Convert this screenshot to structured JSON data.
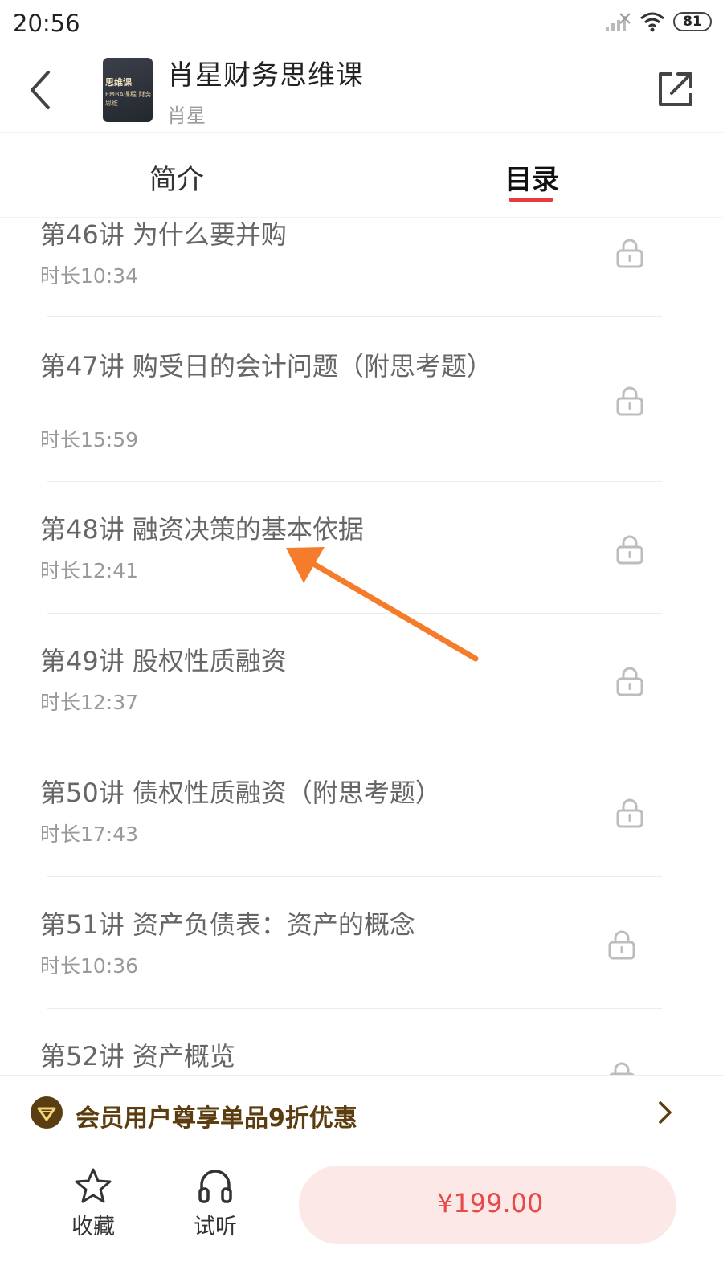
{
  "status_bar": {
    "time": "20:56",
    "battery": "81"
  },
  "header": {
    "title": "肖星财务思维课",
    "author": "肖星",
    "cover_title": "思维课",
    "cover_subtitle": "EMBA课程 财务思维"
  },
  "tabs": [
    {
      "label": "简介",
      "active": false
    },
    {
      "label": "目录",
      "active": true
    }
  ],
  "lessons": [
    {
      "title": "第46讲 为什么要并购",
      "duration": "时长10:34",
      "locked": true
    },
    {
      "title": "第47讲 购受日的会计问题（附思考题）",
      "duration": "时长15:59",
      "locked": true
    },
    {
      "title": "第48讲 融资决策的基本依据",
      "duration": "时长12:41",
      "locked": true
    },
    {
      "title": "第49讲 股权性质融资",
      "duration": "时长12:37",
      "locked": true
    },
    {
      "title": "第50讲 债权性质融资（附思考题）",
      "duration": "时长17:43",
      "locked": true
    },
    {
      "title": "第51讲 资产负债表：资产的概念",
      "duration": "时长10:36",
      "locked": true
    },
    {
      "title": "第52讲 资产概览",
      "duration": "",
      "locked": true
    }
  ],
  "promo": {
    "text": "会员用户尊享单品9折优惠"
  },
  "bottom_bar": {
    "favorite_label": "收藏",
    "trial_label": "试听",
    "price": "¥199.00"
  },
  "colors": {
    "accent": "#e63c3c",
    "annotation_arrow": "#f57c2b",
    "promo_text": "#5b3d10",
    "buy_button_bg": "#fde8e8"
  }
}
